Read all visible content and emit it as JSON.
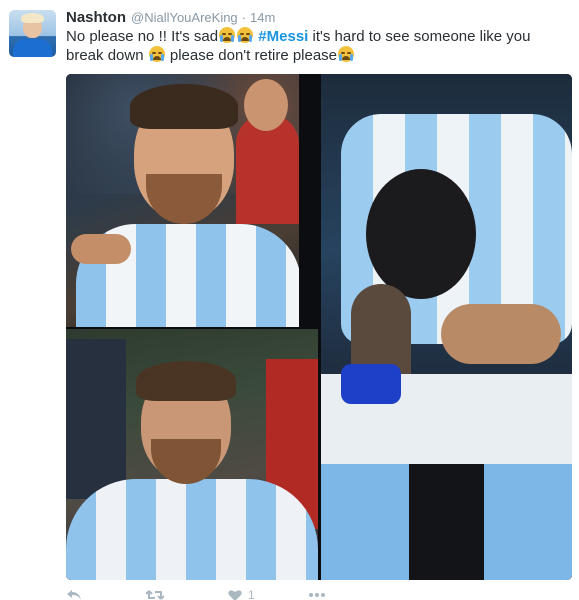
{
  "tweet": {
    "display_name": "Nashton",
    "handle": "@NiallYouAreKing",
    "separator": "·",
    "time": "14m",
    "text_parts": {
      "p1": "No please no !! It's sad",
      "hashtag": "#Messi",
      "p2": " it's hard to see someone like you break down ",
      "p3": " please don't retire please"
    },
    "emoji_name": "loudly-crying-face"
  },
  "actions": {
    "reply_icon": "reply-icon",
    "retweet_icon": "retweet-icon",
    "like_icon": "heart-icon",
    "like_count": "1",
    "more_icon": "more-icon"
  },
  "colors": {
    "hashtag": "#1b95e0",
    "muted": "#8899a6",
    "text": "#292f33"
  }
}
